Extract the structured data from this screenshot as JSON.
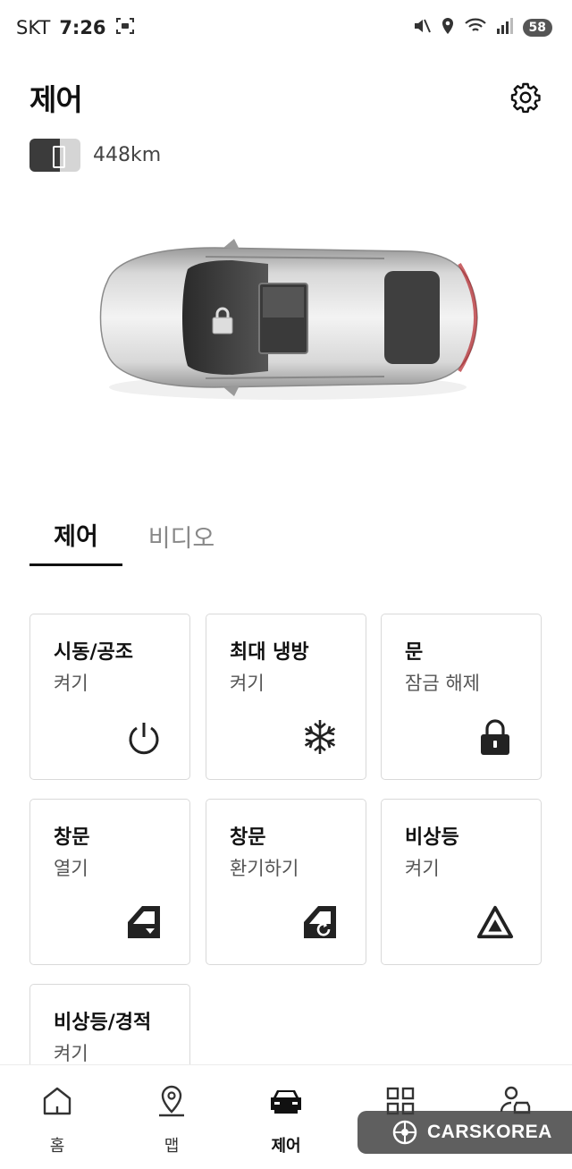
{
  "status_bar": {
    "carrier": "SKT",
    "time": "7:26",
    "battery": "58",
    "icons": [
      "screenshot-icon",
      "mute-vibrate-icon",
      "location-icon",
      "wifi-icon",
      "signal-icon"
    ]
  },
  "header": {
    "title": "제어",
    "settings_icon": "gear-icon"
  },
  "vehicle": {
    "range": "448km",
    "fuel_level": 0.6,
    "lock_status_icon": "lock-icon"
  },
  "tabs": [
    {
      "label": "제어",
      "active": true
    },
    {
      "label": "비디오",
      "active": false
    }
  ],
  "controls": [
    {
      "title": "시동/공조",
      "subtitle": "켜기",
      "icon": "power-icon"
    },
    {
      "title": "최대 냉방",
      "subtitle": "켜기",
      "icon": "snowflake-icon"
    },
    {
      "title": "문",
      "subtitle": "잠금 해제",
      "icon": "lock-icon"
    },
    {
      "title": "창문",
      "subtitle": "열기",
      "icon": "window-open-icon"
    },
    {
      "title": "창문",
      "subtitle": "환기하기",
      "icon": "window-vent-icon"
    },
    {
      "title": "비상등",
      "subtitle": "켜기",
      "icon": "hazard-icon"
    },
    {
      "title": "비상등/경적",
      "subtitle": "켜기",
      "icon": "hazard-horn-icon"
    }
  ],
  "bottom_nav": [
    {
      "label": "홈",
      "icon": "home-icon",
      "active": false
    },
    {
      "label": "맵",
      "icon": "map-pin-icon",
      "active": false
    },
    {
      "label": "제어",
      "icon": "car-icon",
      "active": true
    },
    {
      "label": "",
      "icon": "grid-icon",
      "active": false
    },
    {
      "label": "",
      "icon": "user-car-icon",
      "active": false
    }
  ],
  "watermark": {
    "text": "CARSKOREA"
  },
  "colors": {
    "accent": "#111111",
    "card_border": "#d9d9d9",
    "muted_text": "#888888"
  }
}
